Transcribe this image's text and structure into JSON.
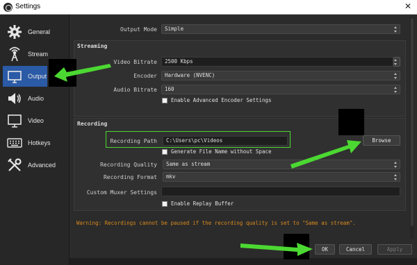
{
  "window": {
    "title": "Settings",
    "close_glyph": "✕"
  },
  "sidebar": {
    "items": [
      {
        "label": "General",
        "icon": "gear-icon"
      },
      {
        "label": "Stream",
        "icon": "antenna-icon"
      },
      {
        "label": "Output",
        "icon": "output-icon",
        "active": true
      },
      {
        "label": "Audio",
        "icon": "speaker-icon"
      },
      {
        "label": "Video",
        "icon": "monitor-icon"
      },
      {
        "label": "Hotkeys",
        "icon": "keyboard-icon"
      },
      {
        "label": "Advanced",
        "icon": "tools-icon"
      }
    ]
  },
  "output_mode": {
    "label": "Output Mode",
    "value": "Simple"
  },
  "streaming": {
    "title": "Streaming",
    "video_bitrate": {
      "label": "Video Bitrate",
      "value": "2500 Kbps"
    },
    "encoder": {
      "label": "Encoder",
      "value": "Hardware (NVENC)"
    },
    "audio_bitrate": {
      "label": "Audio Bitrate",
      "value": "160"
    },
    "advanced_encoder": {
      "label": "Enable Advanced Encoder Settings",
      "checked": false
    }
  },
  "recording": {
    "title": "Recording",
    "path": {
      "label": "Recording Path",
      "value": "C:\\Users\\pc\\Videos"
    },
    "browse_label": "Browse",
    "generate_filename": {
      "label": "Generate File Name without Space",
      "checked": false
    },
    "quality": {
      "label": "Recording Quality",
      "value": "Same as stream"
    },
    "format": {
      "label": "Recording Format",
      "value": "mkv"
    },
    "muxer": {
      "label": "Custom Muxer Settings",
      "value": ""
    },
    "replay_buffer": {
      "label": "Enable Replay Buffer",
      "checked": false
    }
  },
  "warning": "Warning: Recordings cannot be paused if the recording quality is set to \"Same as stream\".",
  "footer": {
    "ok_label": "OK",
    "cancel_label": "Cancel",
    "apply_label": "Apply"
  },
  "colors": {
    "accent": "#2b5aa6",
    "annotation_green": "#4cd832",
    "warning": "#d98a1e"
  }
}
